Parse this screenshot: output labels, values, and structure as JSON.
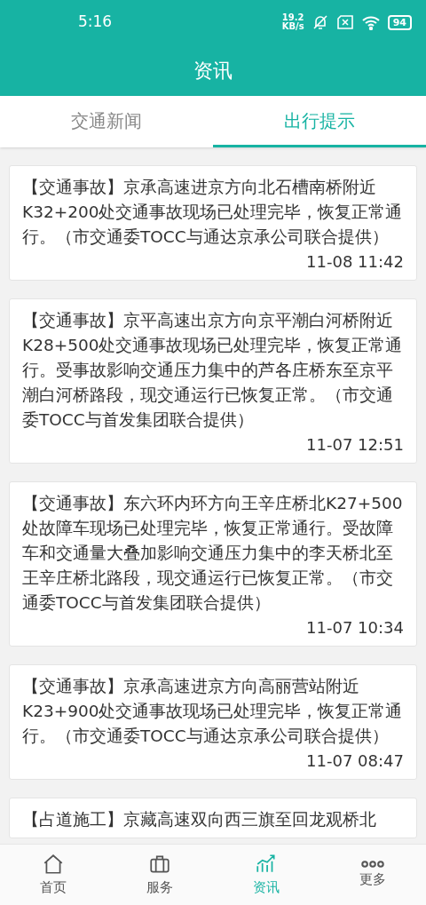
{
  "status_bar": {
    "time": "5:16",
    "speed_value": "19.2",
    "speed_unit": "KB/s",
    "battery": "94"
  },
  "header": {
    "title": "资讯"
  },
  "tabs": [
    {
      "label": "交通新闻",
      "selected": false
    },
    {
      "label": "出行提示",
      "selected": true
    }
  ],
  "news": [
    {
      "text": "【交通事故】京承高速进京方向北石槽南桥附近K32+200处交通事故现场已处理完毕，恢复正常通行。（市交通委TOCC与通达京承公司联合提供）",
      "time": "11-08 11:42"
    },
    {
      "text": "【交通事故】京平高速出京方向京平潮白河桥附近K28+500处交通事故现场已处理完毕，恢复正常通行。受事故影响交通压力集中的芦各庄桥东至京平潮白河桥路段，现交通运行已恢复正常。（市交通委TOCC与首发集团联合提供）",
      "time": "11-07 12:51"
    },
    {
      "text": "【交通事故】东六环内环方向王辛庄桥北K27+500处故障车现场已处理完毕，恢复正常通行。受故障车和交通量大叠加影响交通压力集中的李天桥北至王辛庄桥北路段，现交通运行已恢复正常。（市交通委TOCC与首发集团联合提供）",
      "time": "11-07 10:34"
    },
    {
      "text": "【交通事故】京承高速进京方向高丽营站附近K23+900处交通事故现场已处理完毕，恢复正常通行。（市交通委TOCC与通达京承公司联合提供）",
      "time": "11-07 08:47"
    },
    {
      "text": "【占道施工】京藏高速双向西三旗至回龙观桥北"
    }
  ],
  "bottom_nav": [
    {
      "label": "首页",
      "kind": "home",
      "selected": false
    },
    {
      "label": "服务",
      "kind": "briefcase",
      "selected": false
    },
    {
      "label": "资讯",
      "kind": "chart",
      "selected": true
    },
    {
      "label": "更多",
      "kind": "more",
      "selected": false
    }
  ]
}
